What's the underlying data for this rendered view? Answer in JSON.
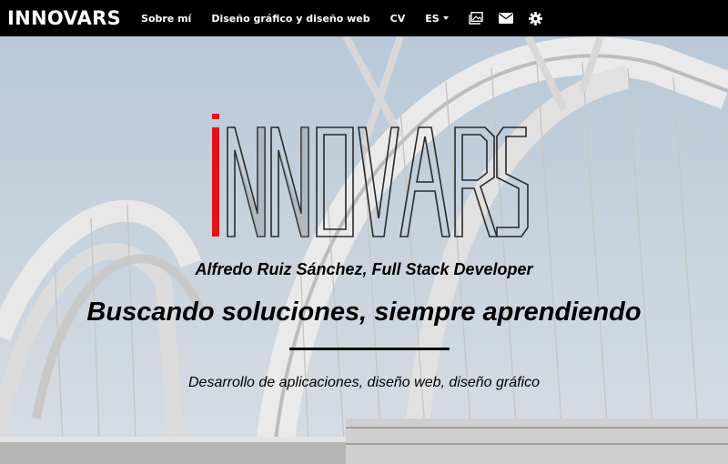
{
  "navbar": {
    "brand": "INNOVARS",
    "links": [
      "Sobre mí",
      "Diseño gráfico y diseño web",
      "CV"
    ],
    "language": "ES",
    "icons": [
      "gallery-icon",
      "envelope-icon",
      "gear-icon"
    ]
  },
  "hero": {
    "logo_text": "INNOVARS",
    "subtitle": "Alfredo Ruiz Sánchez, Full Stack Developer",
    "tagline": "Buscando soluciones, siempre aprendiendo",
    "services": "Desarrollo de aplicaciones, diseño web, diseño gráfico"
  },
  "colors": {
    "navbar_bg": "#000000",
    "logo_accent": "#e0121b",
    "text": "#000000"
  }
}
